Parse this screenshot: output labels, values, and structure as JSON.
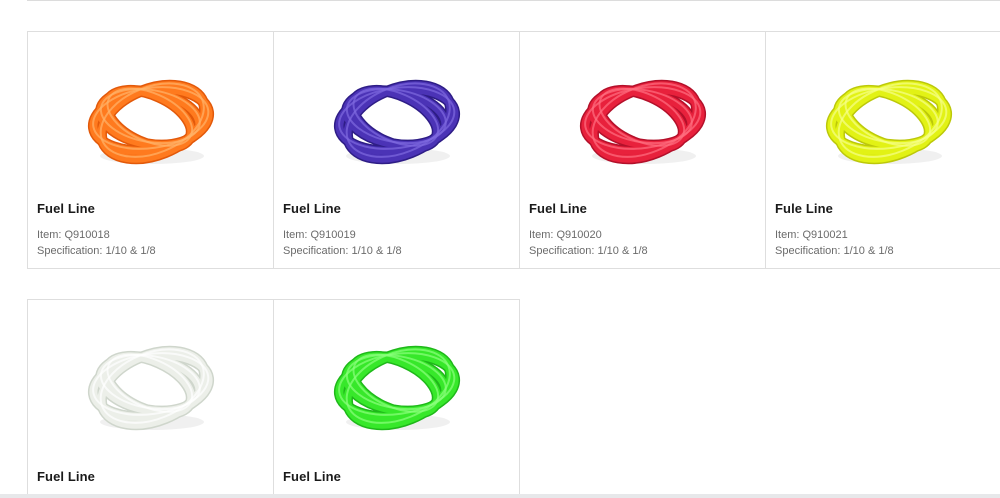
{
  "products": [
    {
      "title": "Fuel Line",
      "item": "Item: Q910018",
      "spec": "Specification: 1/10 & 1/8",
      "image_icon": "orange-tubing-coil-image",
      "color": "#ff7a1e",
      "highlight": "#ffb36a",
      "shadow": "#e2590a"
    },
    {
      "title": "Fuel Line",
      "item": "Item: Q910019",
      "spec": "Specification: 1/10 & 1/8",
      "image_icon": "purple-tubing-coil-image",
      "color": "#4b33b6",
      "highlight": "#7f6ae0",
      "shadow": "#2e1d86"
    },
    {
      "title": "Fuel Line",
      "item": "Item: Q910020",
      "spec": "Specification: 1/10 & 1/8",
      "image_icon": "red-tubing-coil-image",
      "color": "#e8213c",
      "highlight": "#ff6f80",
      "shadow": "#b3102a"
    },
    {
      "title": "Fule Line",
      "item": "Item: Q910021",
      "spec": "Specification: 1/10 & 1/8",
      "image_icon": "yellow-tubing-coil-image",
      "color": "#e2f215",
      "highlight": "#f7ff8a",
      "shadow": "#bcc80a"
    },
    {
      "title": "Fuel Line",
      "image_icon": "clear-tubing-coil-image",
      "color": "#ecefe9",
      "highlight": "#ffffff",
      "shadow": "#cfd6cc"
    },
    {
      "title": "Fuel Line",
      "image_icon": "green-tubing-coil-image",
      "color": "#37e82a",
      "highlight": "#8cff7e",
      "shadow": "#1fb81a"
    }
  ]
}
